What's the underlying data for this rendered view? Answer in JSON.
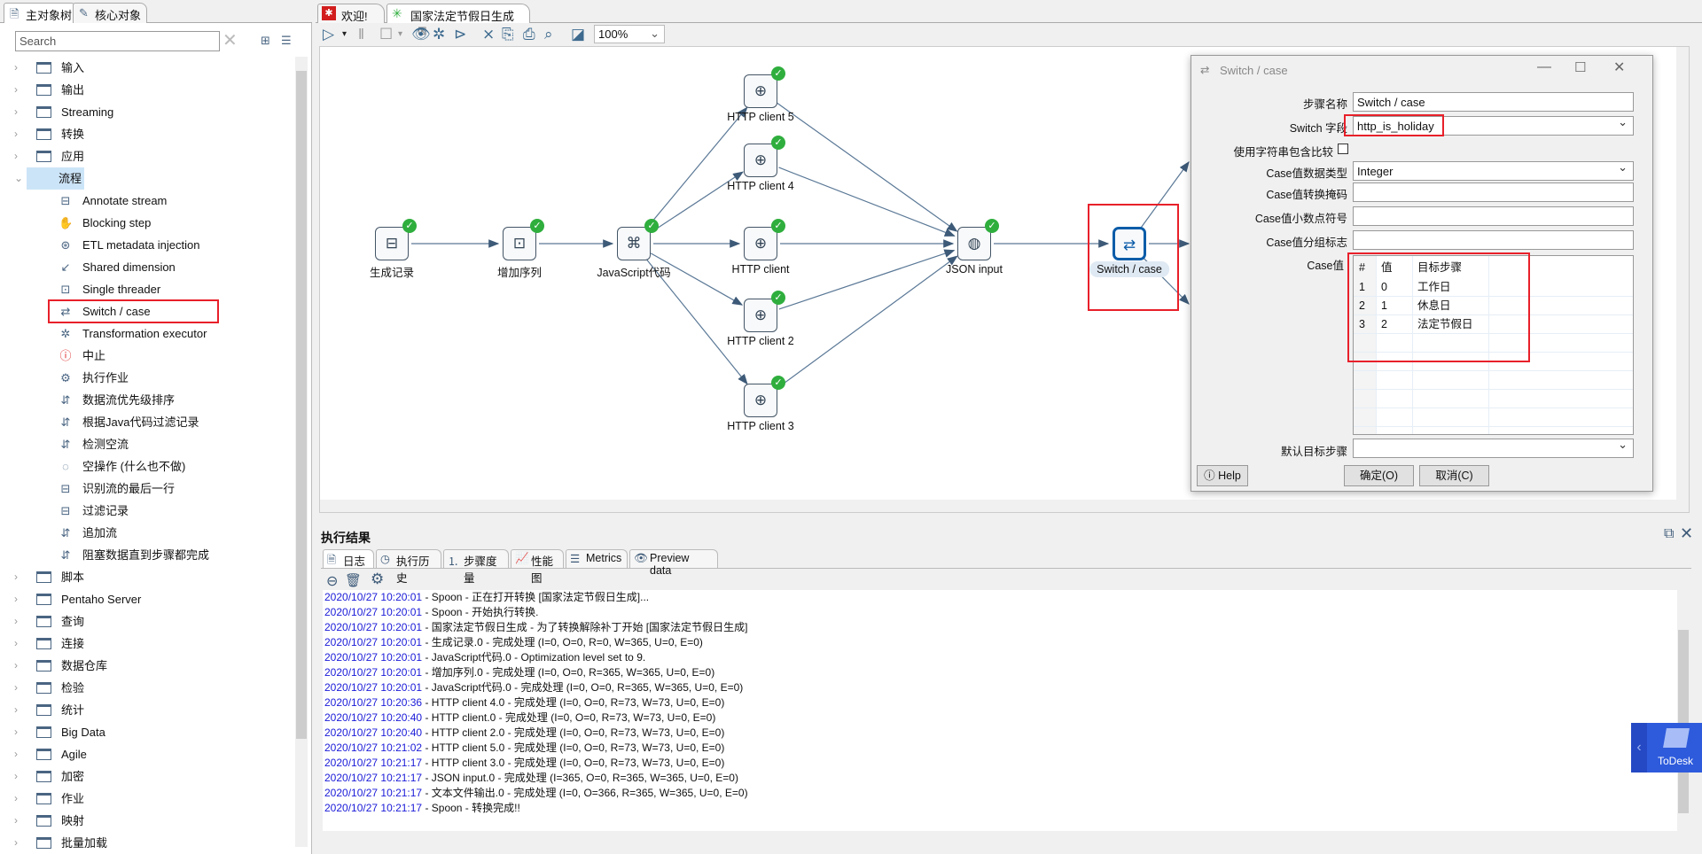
{
  "left_panel": {
    "tabs": [
      "主对象树",
      "核心对象"
    ],
    "search_placeholder": "Search",
    "tree": [
      {
        "label": "输入",
        "type": "folder"
      },
      {
        "label": "输出",
        "type": "folder"
      },
      {
        "label": "Streaming",
        "type": "folder"
      },
      {
        "label": "转换",
        "type": "folder"
      },
      {
        "label": "应用",
        "type": "folder"
      },
      {
        "label": "流程",
        "type": "folder",
        "expanded": true,
        "selected": true
      },
      {
        "label": "Annotate stream",
        "type": "step"
      },
      {
        "label": "Blocking step",
        "type": "step"
      },
      {
        "label": "ETL metadata injection",
        "type": "step"
      },
      {
        "label": "Shared dimension",
        "type": "step"
      },
      {
        "label": "Single threader",
        "type": "step"
      },
      {
        "label": "Switch / case",
        "type": "step",
        "highlighted": true
      },
      {
        "label": "Transformation executor",
        "type": "step"
      },
      {
        "label": "中止",
        "type": "step"
      },
      {
        "label": "执行作业",
        "type": "step"
      },
      {
        "label": "数据流优先级排序",
        "type": "step"
      },
      {
        "label": "根据Java代码过滤记录",
        "type": "step"
      },
      {
        "label": "检测空流",
        "type": "step"
      },
      {
        "label": "空操作 (什么也不做)",
        "type": "step"
      },
      {
        "label": "识别流的最后一行",
        "type": "step"
      },
      {
        "label": "过滤记录",
        "type": "step"
      },
      {
        "label": "追加流",
        "type": "step"
      },
      {
        "label": "阻塞数据直到步骤都完成",
        "type": "step"
      },
      {
        "label": "脚本",
        "type": "folder"
      },
      {
        "label": "Pentaho Server",
        "type": "folder"
      },
      {
        "label": "查询",
        "type": "folder"
      },
      {
        "label": "连接",
        "type": "folder"
      },
      {
        "label": "数据仓库",
        "type": "folder"
      },
      {
        "label": "检验",
        "type": "folder"
      },
      {
        "label": "统计",
        "type": "folder"
      },
      {
        "label": "Big Data",
        "type": "folder"
      },
      {
        "label": "Agile",
        "type": "folder"
      },
      {
        "label": "加密",
        "type": "folder"
      },
      {
        "label": "作业",
        "type": "folder"
      },
      {
        "label": "映射",
        "type": "folder"
      },
      {
        "label": "批量加载",
        "type": "folder"
      }
    ]
  },
  "editor_tabs": [
    {
      "label": "欢迎!"
    },
    {
      "label": "国家法定节假日生成",
      "active": true
    }
  ],
  "toolbar": {
    "zoom": "100%"
  },
  "canvas": {
    "nodes": [
      {
        "label": "生成记录",
        "icon": "generate-rows"
      },
      {
        "label": "增加序列",
        "icon": "sequence"
      },
      {
        "label": "JavaScript代码",
        "icon": "javascript"
      },
      {
        "label": "HTTP client 5",
        "icon": "http"
      },
      {
        "label": "HTTP client 4",
        "icon": "http"
      },
      {
        "label": "HTTP client",
        "icon": "http"
      },
      {
        "label": "HTTP client 2",
        "icon": "http"
      },
      {
        "label": "HTTP client 3",
        "icon": "http"
      },
      {
        "label": "JSON input",
        "icon": "json"
      },
      {
        "label": "Switch / case",
        "icon": "switch",
        "selected": true
      }
    ],
    "hops": [
      [
        0,
        1
      ],
      [
        1,
        2
      ],
      [
        2,
        3
      ],
      [
        2,
        4
      ],
      [
        2,
        5
      ],
      [
        2,
        6
      ],
      [
        2,
        7
      ],
      [
        3,
        8
      ],
      [
        4,
        8
      ],
      [
        5,
        8
      ],
      [
        6,
        8
      ],
      [
        7,
        8
      ],
      [
        8,
        9
      ]
    ],
    "status_color": "#2fae3d"
  },
  "dialog": {
    "title": "Switch / case",
    "step_name_label": "步骤名称",
    "step_name": "Switch / case",
    "switch_field_label": "Switch 字段",
    "switch_field": "http_is_holiday",
    "use_contains_label": "使用字符串包含比较",
    "use_contains": false,
    "case_type_label": "Case值数据类型",
    "case_type": "Integer",
    "mask_label": "Case值转换掩码",
    "mask": "",
    "decimal_label": "Case值小数点符号",
    "decimal": "",
    "grouping_label": "Case值分组标志",
    "grouping": "",
    "case_values_label": "Case值",
    "columns": [
      "#",
      "值",
      "目标步骤"
    ],
    "rows": [
      [
        "1",
        "0",
        "工作日"
      ],
      [
        "2",
        "1",
        "休息日"
      ],
      [
        "3",
        "2",
        "法定节假日"
      ]
    ],
    "default_target_label": "默认目标步骤",
    "default_target": "",
    "help": "Help",
    "ok": "确定(O)",
    "cancel": "取消(C)"
  },
  "results": {
    "title": "执行结果",
    "tabs": [
      "日志",
      "执行历史",
      "步骤度量",
      "性能图",
      "Metrics",
      "Preview data"
    ],
    "log": [
      [
        "2020/10/27 10:20:01",
        " - Spoon - 正在打开转换 [国家法定节假日生成]..."
      ],
      [
        "2020/10/27 10:20:01",
        " - Spoon - 开始执行转换."
      ],
      [
        "2020/10/27 10:20:01",
        " - 国家法定节假日生成 - 为了转换解除补丁开始  [国家法定节假日生成]"
      ],
      [
        "2020/10/27 10:20:01",
        " - 生成记录.0 - 完成处理 (I=0, O=0, R=0, W=365, U=0, E=0)"
      ],
      [
        "2020/10/27 10:20:01",
        " - JavaScript代码.0 - Optimization level set to 9."
      ],
      [
        "2020/10/27 10:20:01",
        " - 增加序列.0 - 完成处理 (I=0, O=0, R=365, W=365, U=0, E=0)"
      ],
      [
        "2020/10/27 10:20:01",
        " - JavaScript代码.0 - 完成处理 (I=0, O=0, R=365, W=365, U=0, E=0)"
      ],
      [
        "2020/10/27 10:20:36",
        " - HTTP client 4.0 - 完成处理 (I=0, O=0, R=73, W=73, U=0, E=0)"
      ],
      [
        "2020/10/27 10:20:40",
        " - HTTP client.0 - 完成处理 (I=0, O=0, R=73, W=73, U=0, E=0)"
      ],
      [
        "2020/10/27 10:20:40",
        " - HTTP client 2.0 - 完成处理 (I=0, O=0, R=73, W=73, U=0, E=0)"
      ],
      [
        "2020/10/27 10:21:02",
        " - HTTP client 5.0 - 完成处理 (I=0, O=0, R=73, W=73, U=0, E=0)"
      ],
      [
        "2020/10/27 10:21:17",
        " - HTTP client 3.0 - 完成处理 (I=0, O=0, R=73, W=73, U=0, E=0)"
      ],
      [
        "2020/10/27 10:21:17",
        " - JSON input.0 - 完成处理 (I=365, O=0, R=365, W=365, U=0, E=0)"
      ],
      [
        "2020/10/27 10:21:17",
        " - 文本文件输出.0 - 完成处理 (I=0, O=366, R=365, W=365, U=0, E=0)"
      ],
      [
        "2020/10/27 10:21:17",
        " - Spoon - 转换完成!!"
      ]
    ]
  },
  "todesk": {
    "label": "ToDesk",
    "color": "#2e5bdc"
  },
  "colors": {
    "highlight": "#e8202a",
    "timestamp": "#1a1ad8",
    "selection": "#cce4f7"
  }
}
